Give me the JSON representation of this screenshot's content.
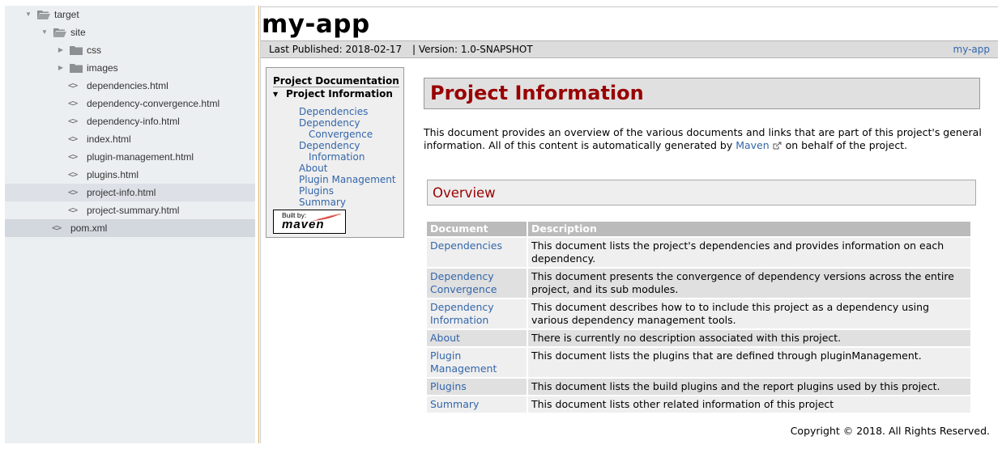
{
  "tree": {
    "items": [
      {
        "label": "target",
        "type": "folder",
        "expanded": true
      },
      {
        "label": "site",
        "type": "folder",
        "expanded": true
      },
      {
        "label": "css",
        "type": "folder",
        "expanded": false
      },
      {
        "label": "images",
        "type": "folder",
        "expanded": false
      },
      {
        "label": "dependencies.html",
        "type": "file",
        "icon": "code-icon"
      },
      {
        "label": "dependency-convergence.html",
        "type": "file",
        "icon": "code-icon"
      },
      {
        "label": "dependency-info.html",
        "type": "file",
        "icon": "code-icon"
      },
      {
        "label": "index.html",
        "type": "file",
        "icon": "code-icon"
      },
      {
        "label": "plugin-management.html",
        "type": "file",
        "icon": "code-icon"
      },
      {
        "label": "plugins.html",
        "type": "file",
        "icon": "code-icon"
      },
      {
        "label": "project-info.html",
        "type": "file",
        "icon": "code-icon",
        "selected": true
      },
      {
        "label": "project-summary.html",
        "type": "file",
        "icon": "code-icon"
      },
      {
        "label": "pom.xml",
        "type": "file",
        "icon": "code-icon",
        "hovered": true
      }
    ]
  },
  "site": {
    "title": "my-app",
    "banner": {
      "published": "Last Published: 2018-02-17",
      "version": "| Version: 1.0-SNAPSHOT",
      "right_link": "my-app"
    },
    "nav": {
      "heading": "Project Documentation",
      "current": "Project Information",
      "links": [
        {
          "lines": [
            "Dependencies"
          ]
        },
        {
          "lines": [
            "Dependency",
            "Convergence"
          ]
        },
        {
          "lines": [
            "Dependency",
            "Information"
          ]
        },
        {
          "lines": [
            "About"
          ]
        },
        {
          "lines": [
            "Plugin Management"
          ]
        },
        {
          "lines": [
            "Plugins"
          ]
        },
        {
          "lines": [
            "Summary"
          ]
        }
      ],
      "built_by": "Built by:",
      "maven_logo": "maven"
    },
    "heading": "Project Information",
    "intro_before": "This document provides an overview of the various documents and links that are part of this project's general information. All of this content is automatically generated by ",
    "intro_link": "Maven",
    "intro_after": " on behalf of the project.",
    "overview_heading": "Overview",
    "table": {
      "headers": [
        "Document",
        "Description"
      ],
      "rows": [
        {
          "doc": "Dependencies",
          "desc": "This document lists the project's dependencies and provides information on each dependency."
        },
        {
          "doc": "Dependency Convergence",
          "desc": "This document presents the convergence of dependency versions across the entire project, and its sub modules."
        },
        {
          "doc": "Dependency Information",
          "desc": "This document describes how to to include this project as a dependency using various dependency management tools."
        },
        {
          "doc": "About",
          "desc": "There is currently no description associated with this project."
        },
        {
          "doc": "Plugin Management",
          "desc": "This document lists the plugins that are defined through pluginManagement."
        },
        {
          "doc": "Plugins",
          "desc": "This document lists the build plugins and the report plugins used by this project."
        },
        {
          "doc": "Summary",
          "desc": "This document lists other related information of this project"
        }
      ]
    },
    "copyright": "Copyright © 2018. All Rights Reserved."
  }
}
